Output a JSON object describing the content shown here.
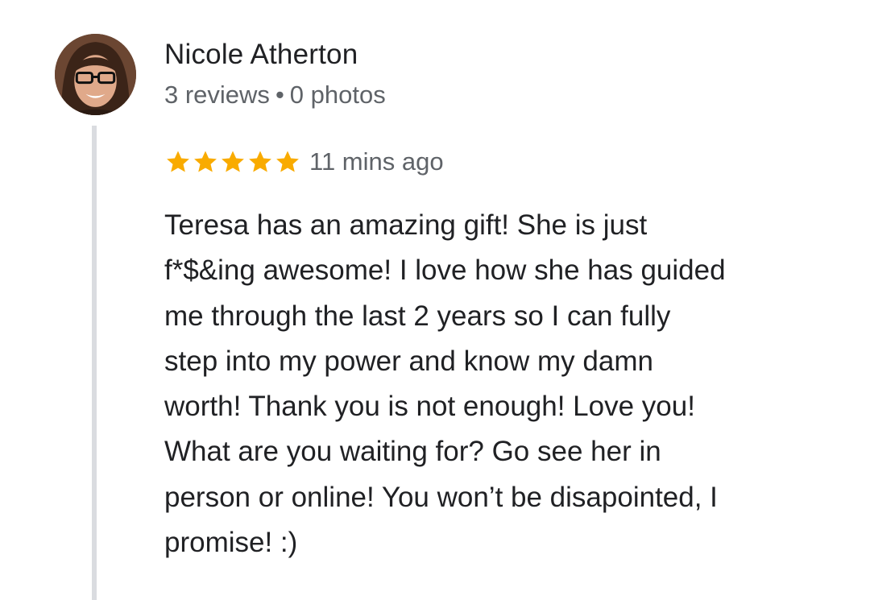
{
  "reviewer": {
    "name": "Nicole Atherton",
    "reviews_count": "3 reviews",
    "separator": "•",
    "photos_count": "0 photos",
    "avatar_icon": "user-avatar-photo"
  },
  "review": {
    "rating": 5,
    "rating_max": 5,
    "star_color": "#f9ab00",
    "timestamp": "11 mins ago",
    "text_lines": [
      "Teresa has an amazing gift! She is just",
      "f*$&ing awesome! I love how she has guided",
      "me through the last 2 years so I can fully",
      "step into my power and know my damn",
      "worth! Thank you is not enough! Love you!",
      "What are you waiting for? Go see her in",
      "person or online! You won’t be disapointed, I",
      "promise! :)"
    ]
  },
  "colors": {
    "primary_text": "#202124",
    "secondary_text": "#5f6368",
    "thread_line": "#dadce0"
  }
}
